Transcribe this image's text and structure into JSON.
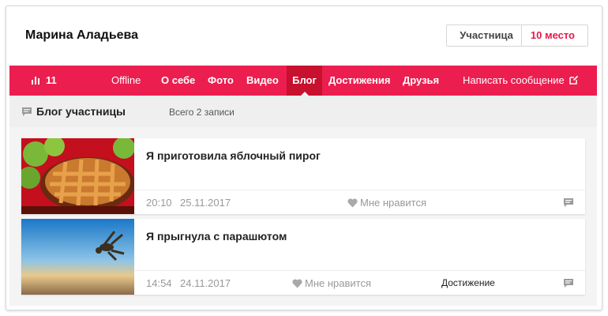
{
  "profile": {
    "name": "Марина Аладьева",
    "status": "Участница",
    "place": "10 место"
  },
  "nav": {
    "rating": "11",
    "items": [
      {
        "label": "Offline"
      },
      {
        "label": "О себе"
      },
      {
        "label": "Фото"
      },
      {
        "label": "Видео"
      },
      {
        "label": "Блог",
        "active": true
      },
      {
        "label": "Достижения"
      },
      {
        "label": "Друзья"
      }
    ],
    "message": "Написать сообщение"
  },
  "blog": {
    "title": "Блог участницы",
    "count": "Всего 2 записи",
    "posts": [
      {
        "title": "Я приготовила яблочный пирог",
        "time": "20:10",
        "date": "25.11.2017",
        "like_label": "Мне нравится",
        "tag": ""
      },
      {
        "title": "Я прыгнула с парашютом",
        "time": "14:54",
        "date": "24.11.2017",
        "like_label": "Мне нравится",
        "tag": "Достижение"
      }
    ]
  },
  "colors": {
    "accent": "#eb1e4f",
    "accent_dark": "#c8102f",
    "place_text": "#e8184a"
  }
}
